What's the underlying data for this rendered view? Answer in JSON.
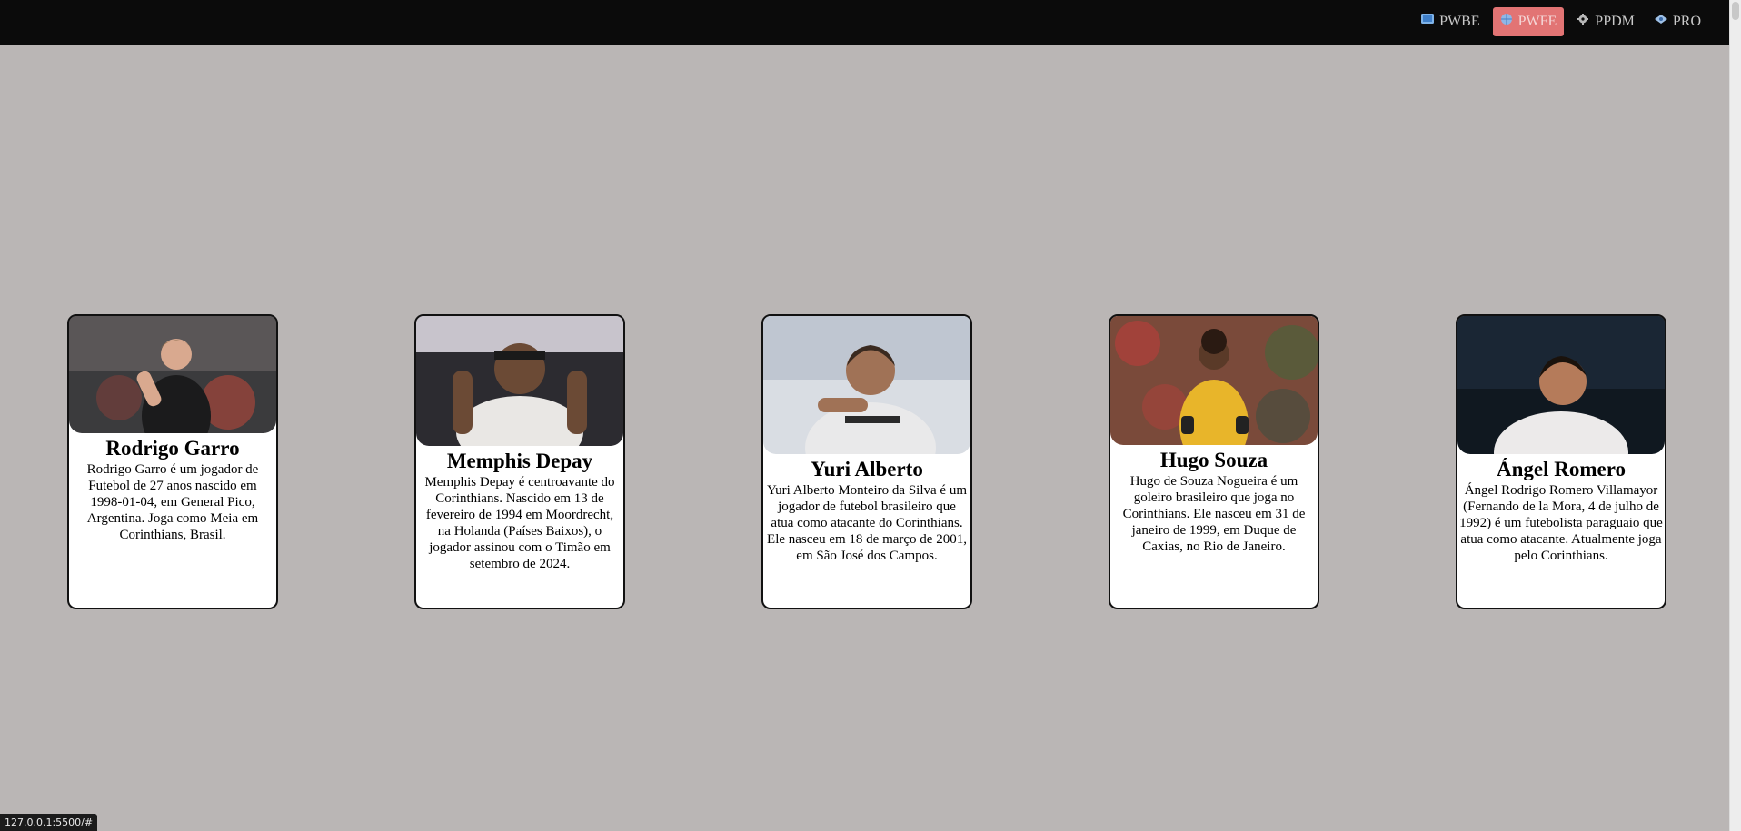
{
  "nav": {
    "items": [
      {
        "label": "PWBE",
        "icon": "book-icon",
        "active": false
      },
      {
        "label": "PWFE",
        "icon": "globe-icon",
        "active": true
      },
      {
        "label": "PPDM",
        "icon": "gear-icon",
        "active": false
      },
      {
        "label": "PRO",
        "icon": "eye-icon",
        "active": false
      }
    ]
  },
  "players": [
    {
      "name": "Rodrigo Garro",
      "description": "Rodrigo Garro é um jogador de Futebol de 27 anos nascido em 1998-01-04, em General Pico, Argentina. Joga como Meia em Corinthians, Brasil.",
      "photo": "player-photo"
    },
    {
      "name": "Memphis Depay",
      "description": "Memphis Depay é centroavante do Corinthians. Nascido em 13 de fevereiro de 1994 em Moordrecht, na Holanda (Países Baixos), o jogador assinou com o Timão em setembro de 2024.",
      "photo": "player-photo"
    },
    {
      "name": "Yuri Alberto",
      "description": "Yuri Alberto Monteiro da Silva é um jogador de futebol brasileiro que atua como atacante do Corinthians. Ele nasceu em 18 de março de 2001, em São José dos Campos.",
      "photo": "player-photo"
    },
    {
      "name": "Hugo Souza",
      "description": "Hugo de Souza Nogueira é um goleiro brasileiro que joga no Corinthians. Ele nasceu em 31 de janeiro de 1999, em Duque de Caxias, no Rio de Janeiro.",
      "photo": "player-photo"
    },
    {
      "name": "Ángel Romero",
      "description": "Ángel Rodrigo Romero Villamayor (Fernando de la Mora, 4 de julho de 1992) é um futebolista paraguaio que atua como atacante. Atualmente joga pelo Corinthians.",
      "photo": "player-photo"
    }
  ],
  "status_bar": {
    "url": "127.0.0.1:5500/#"
  }
}
